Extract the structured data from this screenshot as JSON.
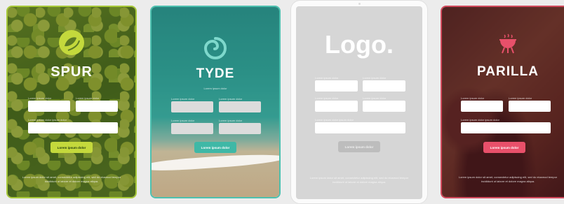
{
  "cards": [
    {
      "brand": "SPUR",
      "field_labels": [
        "Lorem ipsum dolor",
        "Lorem ipsum dolor",
        "Lorem ipsum dolor ipsum dolor"
      ],
      "button_label": "Lorem ipsum dolor",
      "footer": "Lorem ipsum dolor sit amet, consectetur adipiscing elit, sed do eiusmod tempor incididunt ut labore et dolore magna aliqua.",
      "accent": "#c4d93c"
    },
    {
      "brand": "TYDE",
      "subtitle": "Lorem ipsum dolor",
      "field_labels": [
        "Lorem ipsum dolor",
        "Lorem ipsum dolor",
        "Lorem ipsum dolor",
        "Lorem ipsum dolor"
      ],
      "button_label": "Lorem ipsum dolor",
      "accent": "#3fb8a6"
    },
    {
      "brand": "Logo.",
      "field_labels": [
        "Lorem ipsum dolor",
        "Lorem ipsum dolor",
        "Lorem ipsum dolor",
        "Lorem ipsum dolor",
        "Lorem ipsum dolor ipsum dolor"
      ],
      "button_label": "Lorem ipsum dolor",
      "footer": "Lorem ipsum dolor sit amet, consectetur adipiscing elit, sed do eiusmod tempor incididunt ut labore et dolore magna aliqua.",
      "accent": "#bdbdbd"
    },
    {
      "brand": "PARILLA",
      "field_labels": [
        "Lorem ipsum dolor",
        "Lorem ipsum dolor",
        "Lorem ipsum dolor ipsum dolor"
      ],
      "button_label": "Lorem ipsum dolor",
      "footer": "Lorem ipsum dolor sit amet, consectetur adipiscing elit, sed do eiusmod tempor incididunt ut labore et dolore magna aliqua.",
      "accent": "#e8506a"
    }
  ]
}
